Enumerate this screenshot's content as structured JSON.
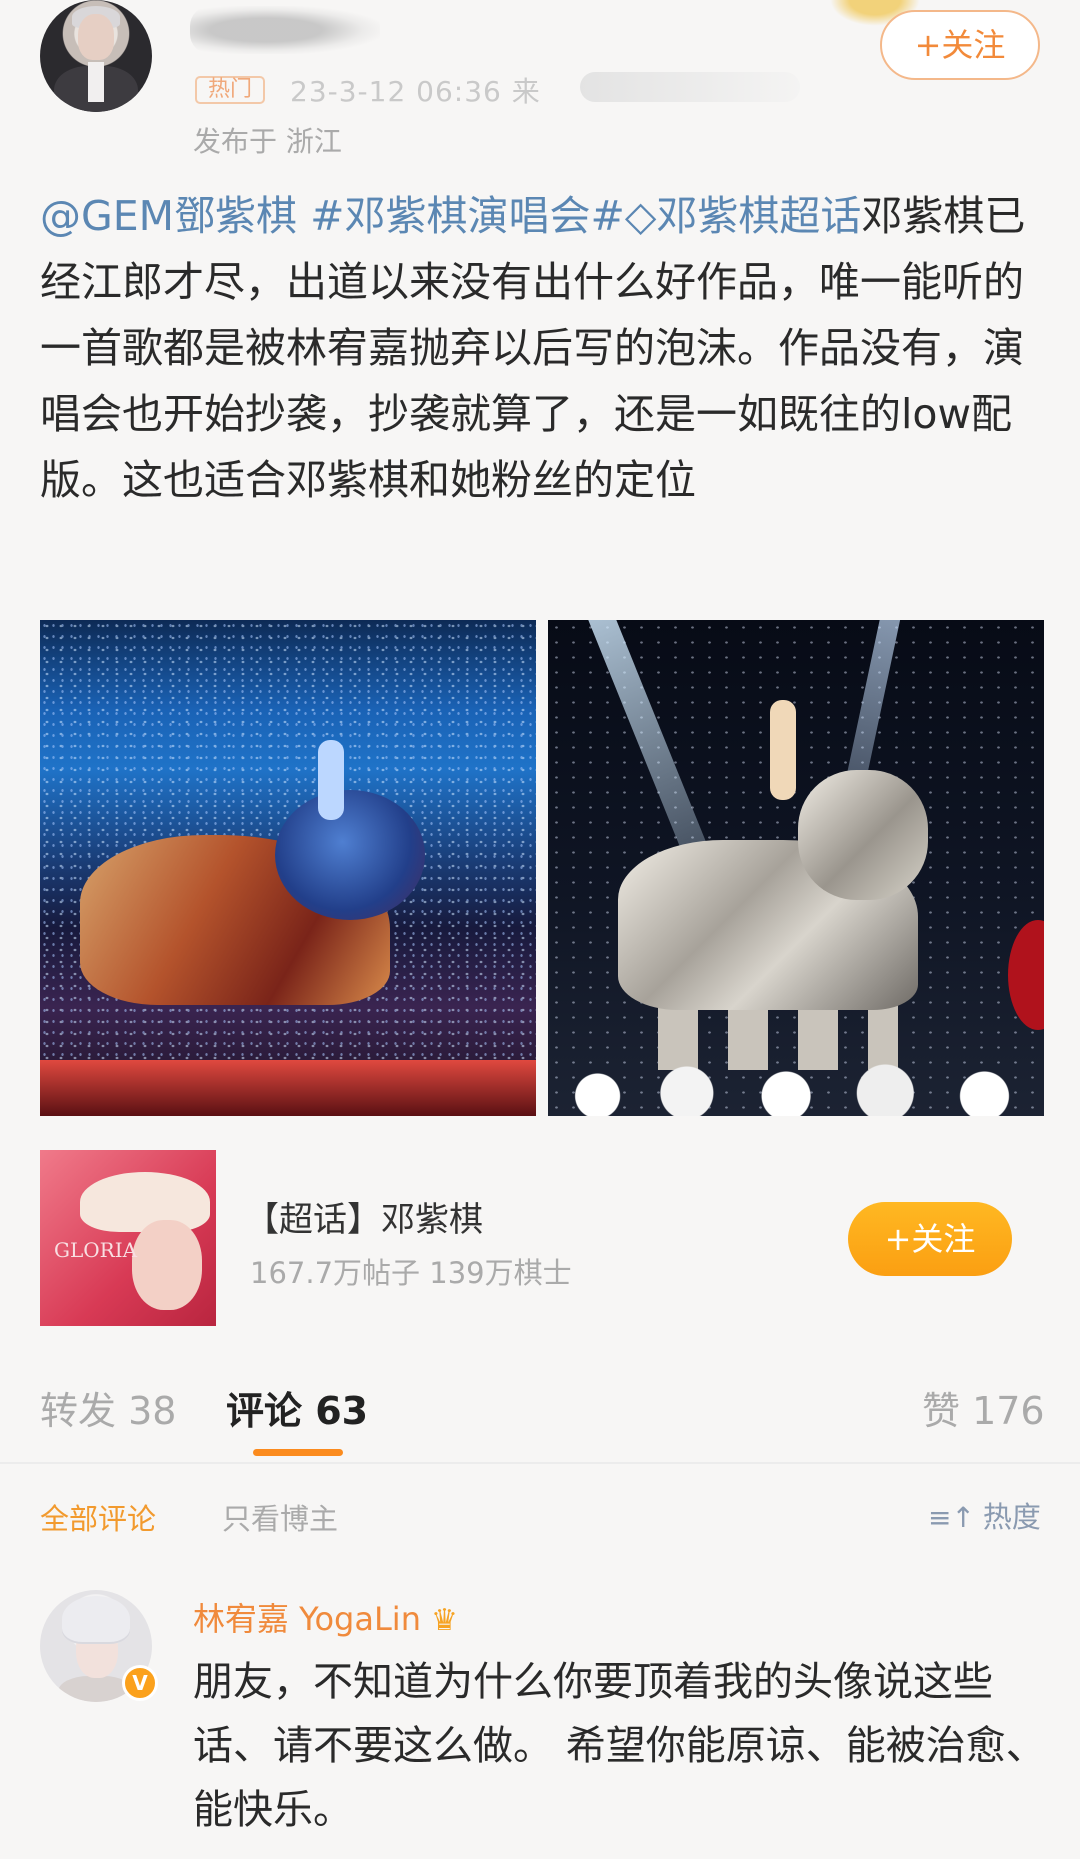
{
  "post": {
    "hot_tag": "热门",
    "time": "23-3-12 06:36",
    "source_prefix": "来",
    "location": "发布于 浙江",
    "follow_label": "+关注",
    "mention": "@GEM鄧紫棋",
    "hashtag": "#邓紫棋演唱会#",
    "supertopic_icon": "diamond-icon",
    "supertopic_link": "◇邓紫棋超话",
    "body": "邓紫棋已经江郎才尽，出道以来没有出什么好作品，唯一能听的一首歌都是被林宥嘉抛弃以后写的泡沫。作品没有，演唱会也开始抄袭，抄袭就算了，还是一如既往的low配版。这也适合邓紫棋和她粉丝的定位"
  },
  "topic_card": {
    "thumb_text": "GLORIA",
    "title": "【超话】邓紫棋",
    "stats": "167.7万帖子 139万棋士",
    "follow_label": "+关注"
  },
  "tabs": {
    "repost": "转发 38",
    "comment": "评论 63",
    "like": "赞 176"
  },
  "filters": {
    "all": "全部评论",
    "owner_only": "只看博主",
    "sort_icon": "≡↑",
    "sort": "热度"
  },
  "comment": {
    "author": "林宥嘉 YogaLin",
    "crown_icon": "♛",
    "verified": "V",
    "text": "朋友，不知道为什么你要顶着我的头像说这些话、请不要这么做。 希望你能原谅、能被治愈、能快乐。"
  },
  "colors": {
    "link": "#5b87b3",
    "accent_orange": "#fb9f12",
    "name_orange": "#f08a3c"
  }
}
